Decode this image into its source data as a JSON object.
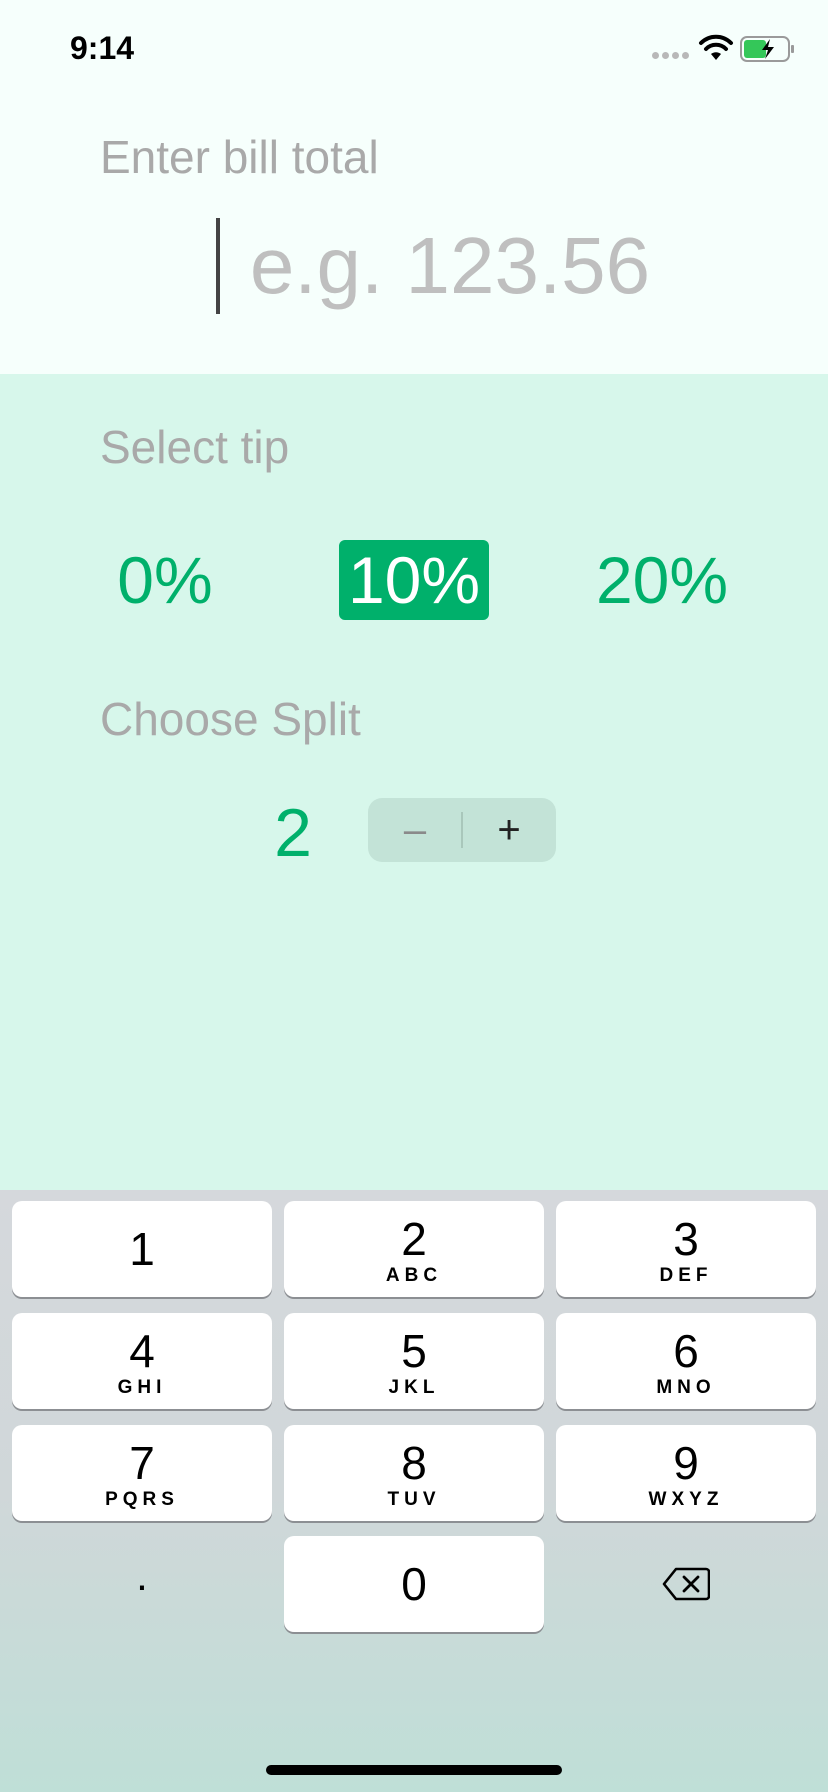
{
  "status_bar": {
    "time": "9:14",
    "icons": [
      "signal-dots-icon",
      "wifi-icon",
      "battery-charging-icon"
    ]
  },
  "bill": {
    "label": "Enter bill total",
    "placeholder": "e.g. 123.56",
    "value": ""
  },
  "tip": {
    "label": "Select tip",
    "options": [
      "0%",
      "10%",
      "20%"
    ],
    "selected": "10%"
  },
  "split": {
    "label": "Choose Split",
    "value": "2",
    "minus_label": "–",
    "plus_label": "+"
  },
  "keyboard": {
    "keys": [
      {
        "digit": "1",
        "letters": ""
      },
      {
        "digit": "2",
        "letters": "ABC"
      },
      {
        "digit": "3",
        "letters": "DEF"
      },
      {
        "digit": "4",
        "letters": "GHI"
      },
      {
        "digit": "5",
        "letters": "JKL"
      },
      {
        "digit": "6",
        "letters": "MNO"
      },
      {
        "digit": "7",
        "letters": "PQRS"
      },
      {
        "digit": "8",
        "letters": "TUV"
      },
      {
        "digit": "9",
        "letters": "WXYZ"
      },
      {
        "digit": "0",
        "letters": ""
      }
    ],
    "decimal": ".",
    "delete_icon": "backspace-icon"
  },
  "colors": {
    "accent": "#00b06b",
    "top_background": "#f6fffc",
    "mid_background": "#d7f7eb",
    "label_gray": "#a9a9a9",
    "battery_green": "#34c759"
  }
}
